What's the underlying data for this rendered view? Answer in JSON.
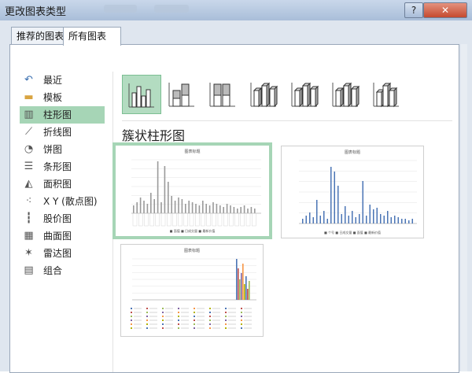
{
  "window": {
    "title": "更改图表类型",
    "help": "?",
    "close": "✕"
  },
  "tabs": [
    {
      "label": "推荐的图表",
      "active": false
    },
    {
      "label": "所有图表",
      "active": true
    }
  ],
  "sidebar": {
    "selected_index": 2,
    "items": [
      {
        "label": "最近",
        "icon": "recent-icon"
      },
      {
        "label": "模板",
        "icon": "folder-icon"
      },
      {
        "label": "柱形图",
        "icon": "column-chart-icon"
      },
      {
        "label": "折线图",
        "icon": "line-chart-icon"
      },
      {
        "label": "饼图",
        "icon": "pie-chart-icon"
      },
      {
        "label": "条形图",
        "icon": "bar-chart-icon"
      },
      {
        "label": "面积图",
        "icon": "area-chart-icon"
      },
      {
        "label": "X Y (散点图)",
        "icon": "scatter-chart-icon"
      },
      {
        "label": "股价图",
        "icon": "stock-chart-icon"
      },
      {
        "label": "曲面图",
        "icon": "surface-chart-icon"
      },
      {
        "label": "雷达图",
        "icon": "radar-chart-icon"
      },
      {
        "label": "组合",
        "icon": "combo-chart-icon"
      }
    ]
  },
  "subtypes": [
    {
      "name": "clustered-column",
      "selected": true
    },
    {
      "name": "stacked-column",
      "selected": false
    },
    {
      "name": "100-stacked-column",
      "selected": false
    },
    {
      "name": "3d-clustered-column",
      "selected": false
    },
    {
      "name": "3d-stacked-column",
      "selected": false
    },
    {
      "name": "3d-100-stacked-column",
      "selected": false
    },
    {
      "name": "3d-column",
      "selected": false
    }
  ],
  "heading": "簇状柱形图",
  "previews": [
    {
      "title": "图表标题",
      "selected": true,
      "legend": "■ 面值   ■ 日成交量   ■ 最新价值"
    },
    {
      "title": "图表标题",
      "selected": false,
      "legend": "■ 个号   ■ 日成交量   ■ 面值   ■ 最新价值"
    },
    {
      "title": "图表标题",
      "selected": false,
      "legend": ""
    }
  ],
  "colors": {
    "accent": "#a6d5b6",
    "bar_blue": "#4a74b5",
    "bar_gray": "#9a9a9a"
  }
}
